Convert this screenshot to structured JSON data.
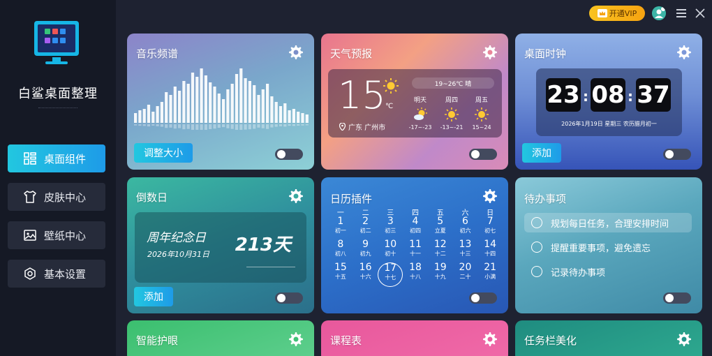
{
  "app": {
    "title": "白鲨桌面整理"
  },
  "nav": [
    {
      "label": "桌面组件",
      "icon": "widgets-icon",
      "active": true
    },
    {
      "label": "皮肤中心",
      "icon": "shirt-icon",
      "active": false
    },
    {
      "label": "壁纸中心",
      "icon": "image-icon",
      "active": false
    },
    {
      "label": "基本设置",
      "icon": "hexagon-settings-icon",
      "active": false
    }
  ],
  "topbar": {
    "vip_label": "开通VIP"
  },
  "cards": {
    "music": {
      "title": "音乐频谱",
      "button": "调整大小"
    },
    "weather": {
      "title": "天气预报",
      "temp": "15",
      "unit": "℃",
      "range": "19~26℃ 晴",
      "location": "广东 广州市",
      "forecast": [
        {
          "day": "明天",
          "icon": "partly-cloudy-icon",
          "range": "-17~-23"
        },
        {
          "day": "周四",
          "icon": "sun-icon",
          "range": "-13~-21"
        },
        {
          "day": "周五",
          "icon": "sun-icon",
          "range": "15~24"
        }
      ]
    },
    "clock": {
      "title": "桌面时钟",
      "hours": "23",
      "minutes": "08",
      "seconds": "37",
      "date": "2026年1月19日  星期三  农历腊月初一",
      "button": "添加"
    },
    "countdown": {
      "title": "倒数日",
      "name": "周年纪念日",
      "date": "2026年10月31日",
      "days": "213天",
      "button": "添加"
    },
    "calendar": {
      "title": "日历插件",
      "weekdays": [
        "一",
        "二",
        "三",
        "四",
        "五",
        "六",
        "日"
      ],
      "weeks": [
        [
          {
            "d": "1",
            "l": "初一"
          },
          {
            "d": "2",
            "l": "初二"
          },
          {
            "d": "3",
            "l": "初三"
          },
          {
            "d": "4",
            "l": "初四"
          },
          {
            "d": "5",
            "l": "立夏"
          },
          {
            "d": "6",
            "l": "初六"
          },
          {
            "d": "7",
            "l": "初七"
          }
        ],
        [
          {
            "d": "8",
            "l": "初八"
          },
          {
            "d": "9",
            "l": "初九"
          },
          {
            "d": "10",
            "l": "初十"
          },
          {
            "d": "11",
            "l": "十一"
          },
          {
            "d": "12",
            "l": "十二"
          },
          {
            "d": "13",
            "l": "十三"
          },
          {
            "d": "14",
            "l": "十四"
          }
        ],
        [
          {
            "d": "15",
            "l": "十五"
          },
          {
            "d": "16",
            "l": "十六"
          },
          {
            "d": "17",
            "l": "十七"
          },
          {
            "d": "18",
            "l": "十八"
          },
          {
            "d": "19",
            "l": "十九"
          },
          {
            "d": "20",
            "l": "二十"
          },
          {
            "d": "21",
            "l": "小满"
          }
        ]
      ],
      "today": "17"
    },
    "todo": {
      "title": "待办事项",
      "items": [
        "规划每日任务，合理安排时间",
        "提醒重要事项，避免遗忘",
        "记录待办事项"
      ]
    },
    "eye": {
      "title": "智能护眼"
    },
    "schedule": {
      "title": "课程表"
    },
    "taskbar": {
      "title": "任务栏美化"
    }
  },
  "colors": {
    "accent": "#1e9be8",
    "sidebar": "#151925",
    "main_bg": "#1e2231",
    "vip": "#f9c320"
  }
}
